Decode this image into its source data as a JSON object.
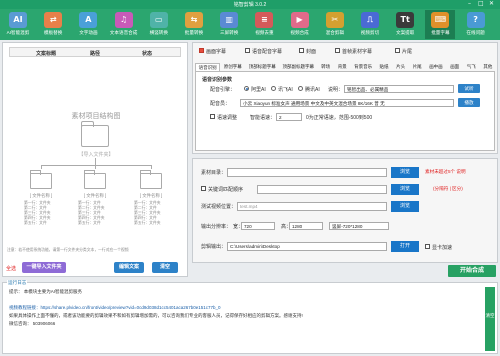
{
  "window": {
    "title": "铭智剪辑 3.0.2",
    "min_icon": "minimize-icon",
    "max_icon": "maximize-icon",
    "close_icon": "close-icon",
    "min_glyph": "–",
    "max_glyph": "□",
    "close_glyph": "✕"
  },
  "toolbar": {
    "items": [
      {
        "label": "AI智能混剪",
        "icon": "ai-robot-icon",
        "glyph": "AI",
        "color": "#5a9bd4"
      },
      {
        "label": "模板替换",
        "icon": "template-swap-icon",
        "glyph": "⇄",
        "color": "#e8804a"
      },
      {
        "label": "文字动画",
        "icon": "text-animation-icon",
        "glyph": "A",
        "color": "#4aa0d8"
      },
      {
        "label": "文本语音合成",
        "icon": "text-to-speech-icon",
        "glyph": "♫",
        "color": "#c85ab8"
      },
      {
        "label": "横竖转换",
        "icon": "orientation-convert-icon",
        "glyph": "▭",
        "color": "#4fb3a8"
      },
      {
        "label": "批量转换",
        "icon": "batch-convert-icon",
        "glyph": "⇆",
        "color": "#e0a040"
      },
      {
        "label": "三屏转换",
        "icon": "three-screen-icon",
        "glyph": "▥",
        "color": "#5a8ad4"
      },
      {
        "label": "视频去重",
        "icon": "dedupe-icon",
        "glyph": "≡",
        "color": "#d45a5a"
      },
      {
        "label": "视频合成",
        "icon": "video-merge-icon",
        "glyph": "▶",
        "color": "#e06a8a"
      },
      {
        "label": "混合剪辑",
        "icon": "mix-edit-icon",
        "glyph": "✂",
        "color": "#d4a030"
      },
      {
        "label": "视频剪切",
        "icon": "video-cut-icon",
        "glyph": "⎍",
        "color": "#4a6ad4"
      },
      {
        "label": "文案提取",
        "icon": "copy-extract-icon",
        "glyph": "Tt",
        "color": "#3a3a3a"
      },
      {
        "label": "批量字幕",
        "icon": "batch-subtitle-icon",
        "glyph": "⌨",
        "color": "#e0902a"
      },
      {
        "label": "在线问题",
        "icon": "online-help-icon",
        "glyph": "?",
        "color": "#4a9ad4"
      }
    ],
    "active_index": 12
  },
  "material_table": {
    "headers": [
      "文案标题",
      "路径",
      "状态"
    ],
    "placeholder_title": "素材项目结构图",
    "import_hint": "【导入文件夹】",
    "folders": [
      {
        "label": "[ 文件名称 ]",
        "items": [
          "第一行：文件夹",
          "第二行：文件",
          "第三行：文件夹",
          "第四行：文件夹",
          "第五行：文件"
        ]
      },
      {
        "label": "[ 文件名称 ]",
        "items": [
          "第一行：文件",
          "第二行：文件夹",
          "第三行：文件",
          "第四行：文件夹",
          "第五行：文件"
        ]
      },
      {
        "label": "[ 文件名称 ]",
        "items": [
          "第一行：文件夹",
          "第二行：文件",
          "第三行：文件夹",
          "第四行：文件",
          "第五行：文件夹"
        ]
      }
    ],
    "note": "注意：若不使用系统功能，请第一行文件夹分类文本，一行对应一个视频"
  },
  "left_buttons": {
    "select_all": "全选",
    "import_folder": "一键导入文件夹",
    "clear": "清空",
    "edit_copy": "编辑文案"
  },
  "options": {
    "items": [
      {
        "label": "画面字幕",
        "checked": true
      },
      {
        "label": "语音配音字幕",
        "checked": false
      },
      {
        "label": "封面",
        "checked": false
      },
      {
        "label": "首帧素材字幕",
        "checked": false
      },
      {
        "label": "片尾",
        "checked": false
      }
    ]
  },
  "tabs": [
    "语音识别",
    "原创字幕",
    "顶部标题字幕",
    "顶部副标题字幕",
    "转场",
    "背景",
    "背景音乐",
    "贴纸",
    "片头",
    "片尾",
    "画中画",
    "画面",
    "气飞",
    "其他"
  ],
  "active_tab": 0,
  "recognition": {
    "section_title": "语音识别参数",
    "voice_type_label": "配音引擎：",
    "engines": [
      {
        "label": "阿里AI",
        "selected": true
      },
      {
        "label": "讯飞AI",
        "selected": false
      },
      {
        "label": "腾讯AI",
        "selected": false
      }
    ],
    "speaker_label": "说明：",
    "speaker_value": "铭智出品、必属精品",
    "voice_label": "配音员：",
    "voice_value": "小云 Xiaoyun 标准女声 通用场景 中文及中英文混合场景 8K/16K 普 无",
    "speed_cb_label": "语速调整",
    "speed_label": "智能语速：",
    "speed_value": "2",
    "speed_hint": "0为正常语速，范围-500到500",
    "test_button": "试听",
    "play_button": "播放"
  },
  "output": {
    "material_dir_label": "素材目录：",
    "material_dir_value": "",
    "browse_label": "浏览",
    "material_hint": "素材未超过5个 说明",
    "keyword_cb_label": "关键词匹配顺序",
    "keyword_hint": "(分隔符 | 区分)",
    "test_video_label": "测试视频位置：",
    "test_video_value": "test.mp4",
    "resolution_label": "输出分辨率：",
    "width_label": "宽：",
    "width_value": "720",
    "height_label": "高：",
    "height_value": "1280",
    "preset_value": "竖屏-720*1280",
    "output_dir_label": "剪辑输出：",
    "output_dir_value": "C:\\Users\\admin\\Desktop",
    "open_label": "打开",
    "gpu_label": "显卡加速",
    "gpu_checked": false
  },
  "start_button": "开始合成",
  "log": {
    "label": "运行日志",
    "lines": [
      "提示：  本模块主要为AI智能混剪服务",
      "",
      "视频教程链接：https://share.plvideo.cn/front/video/preview?vid=0cd9d038d1cc5401aca267b0e151c77b_0",
      "如果具体操作上面不懂的，或者该功能要的剪辑效果不和如有剪辑增加需的，可以咨询我们专业的客服人员，记得保存好相应的剪辑方案。感谢支持!",
      "微信咨询：  503906066"
    ],
    "scroll_label": "清空"
  }
}
